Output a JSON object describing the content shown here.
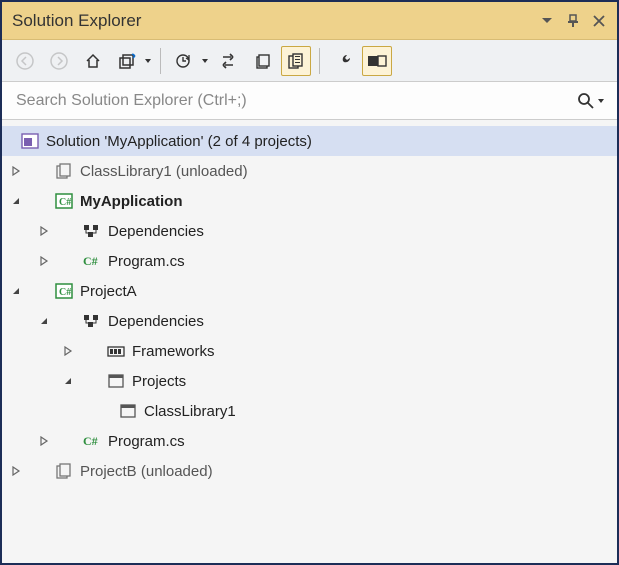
{
  "title": "Solution Explorer",
  "search": {
    "placeholder": "Search Solution Explorer (Ctrl+;)"
  },
  "toolbar": {
    "back": "Back",
    "forward": "Forward",
    "home": "Home",
    "switch_views": "Switch Views",
    "pending": "Pending Changes Filter",
    "sync": "Sync with Active Document",
    "refresh": "Refresh",
    "collapse": "Collapse All",
    "show_all": "Show All Files",
    "properties": "Properties",
    "preview": "Preview Selected Items"
  },
  "nodes": {
    "solution": "Solution 'MyApplication' (2 of 4 projects)",
    "classlib1": "ClassLibrary1 (unloaded)",
    "myapp": "MyApplication",
    "myapp_deps": "Dependencies",
    "myapp_program": "Program.cs",
    "projA": "ProjectA",
    "projA_deps": "Dependencies",
    "projA_frameworks": "Frameworks",
    "projA_projects": "Projects",
    "projA_ref_classlib1": "ClassLibrary1",
    "projA_program": "Program.cs",
    "projB": "ProjectB (unloaded)"
  }
}
